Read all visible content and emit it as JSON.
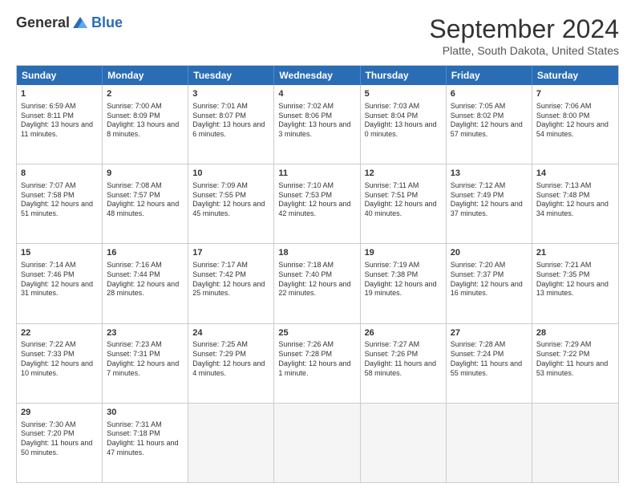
{
  "header": {
    "logo_general": "General",
    "logo_blue": "Blue",
    "title": "September 2024",
    "location": "Platte, South Dakota, United States"
  },
  "days": [
    "Sunday",
    "Monday",
    "Tuesday",
    "Wednesday",
    "Thursday",
    "Friday",
    "Saturday"
  ],
  "rows": [
    [
      {
        "day": "1",
        "sunrise": "Sunrise: 6:59 AM",
        "sunset": "Sunset: 8:11 PM",
        "daylight": "Daylight: 13 hours and 11 minutes."
      },
      {
        "day": "2",
        "sunrise": "Sunrise: 7:00 AM",
        "sunset": "Sunset: 8:09 PM",
        "daylight": "Daylight: 13 hours and 8 minutes."
      },
      {
        "day": "3",
        "sunrise": "Sunrise: 7:01 AM",
        "sunset": "Sunset: 8:07 PM",
        "daylight": "Daylight: 13 hours and 6 minutes."
      },
      {
        "day": "4",
        "sunrise": "Sunrise: 7:02 AM",
        "sunset": "Sunset: 8:06 PM",
        "daylight": "Daylight: 13 hours and 3 minutes."
      },
      {
        "day": "5",
        "sunrise": "Sunrise: 7:03 AM",
        "sunset": "Sunset: 8:04 PM",
        "daylight": "Daylight: 13 hours and 0 minutes."
      },
      {
        "day": "6",
        "sunrise": "Sunrise: 7:05 AM",
        "sunset": "Sunset: 8:02 PM",
        "daylight": "Daylight: 12 hours and 57 minutes."
      },
      {
        "day": "7",
        "sunrise": "Sunrise: 7:06 AM",
        "sunset": "Sunset: 8:00 PM",
        "daylight": "Daylight: 12 hours and 54 minutes."
      }
    ],
    [
      {
        "day": "8",
        "sunrise": "Sunrise: 7:07 AM",
        "sunset": "Sunset: 7:58 PM",
        "daylight": "Daylight: 12 hours and 51 minutes."
      },
      {
        "day": "9",
        "sunrise": "Sunrise: 7:08 AM",
        "sunset": "Sunset: 7:57 PM",
        "daylight": "Daylight: 12 hours and 48 minutes."
      },
      {
        "day": "10",
        "sunrise": "Sunrise: 7:09 AM",
        "sunset": "Sunset: 7:55 PM",
        "daylight": "Daylight: 12 hours and 45 minutes."
      },
      {
        "day": "11",
        "sunrise": "Sunrise: 7:10 AM",
        "sunset": "Sunset: 7:53 PM",
        "daylight": "Daylight: 12 hours and 42 minutes."
      },
      {
        "day": "12",
        "sunrise": "Sunrise: 7:11 AM",
        "sunset": "Sunset: 7:51 PM",
        "daylight": "Daylight: 12 hours and 40 minutes."
      },
      {
        "day": "13",
        "sunrise": "Sunrise: 7:12 AM",
        "sunset": "Sunset: 7:49 PM",
        "daylight": "Daylight: 12 hours and 37 minutes."
      },
      {
        "day": "14",
        "sunrise": "Sunrise: 7:13 AM",
        "sunset": "Sunset: 7:48 PM",
        "daylight": "Daylight: 12 hours and 34 minutes."
      }
    ],
    [
      {
        "day": "15",
        "sunrise": "Sunrise: 7:14 AM",
        "sunset": "Sunset: 7:46 PM",
        "daylight": "Daylight: 12 hours and 31 minutes."
      },
      {
        "day": "16",
        "sunrise": "Sunrise: 7:16 AM",
        "sunset": "Sunset: 7:44 PM",
        "daylight": "Daylight: 12 hours and 28 minutes."
      },
      {
        "day": "17",
        "sunrise": "Sunrise: 7:17 AM",
        "sunset": "Sunset: 7:42 PM",
        "daylight": "Daylight: 12 hours and 25 minutes."
      },
      {
        "day": "18",
        "sunrise": "Sunrise: 7:18 AM",
        "sunset": "Sunset: 7:40 PM",
        "daylight": "Daylight: 12 hours and 22 minutes."
      },
      {
        "day": "19",
        "sunrise": "Sunrise: 7:19 AM",
        "sunset": "Sunset: 7:38 PM",
        "daylight": "Daylight: 12 hours and 19 minutes."
      },
      {
        "day": "20",
        "sunrise": "Sunrise: 7:20 AM",
        "sunset": "Sunset: 7:37 PM",
        "daylight": "Daylight: 12 hours and 16 minutes."
      },
      {
        "day": "21",
        "sunrise": "Sunrise: 7:21 AM",
        "sunset": "Sunset: 7:35 PM",
        "daylight": "Daylight: 12 hours and 13 minutes."
      }
    ],
    [
      {
        "day": "22",
        "sunrise": "Sunrise: 7:22 AM",
        "sunset": "Sunset: 7:33 PM",
        "daylight": "Daylight: 12 hours and 10 minutes."
      },
      {
        "day": "23",
        "sunrise": "Sunrise: 7:23 AM",
        "sunset": "Sunset: 7:31 PM",
        "daylight": "Daylight: 12 hours and 7 minutes."
      },
      {
        "day": "24",
        "sunrise": "Sunrise: 7:25 AM",
        "sunset": "Sunset: 7:29 PM",
        "daylight": "Daylight: 12 hours and 4 minutes."
      },
      {
        "day": "25",
        "sunrise": "Sunrise: 7:26 AM",
        "sunset": "Sunset: 7:28 PM",
        "daylight": "Daylight: 12 hours and 1 minute."
      },
      {
        "day": "26",
        "sunrise": "Sunrise: 7:27 AM",
        "sunset": "Sunset: 7:26 PM",
        "daylight": "Daylight: 11 hours and 58 minutes."
      },
      {
        "day": "27",
        "sunrise": "Sunrise: 7:28 AM",
        "sunset": "Sunset: 7:24 PM",
        "daylight": "Daylight: 11 hours and 55 minutes."
      },
      {
        "day": "28",
        "sunrise": "Sunrise: 7:29 AM",
        "sunset": "Sunset: 7:22 PM",
        "daylight": "Daylight: 11 hours and 53 minutes."
      }
    ],
    [
      {
        "day": "29",
        "sunrise": "Sunrise: 7:30 AM",
        "sunset": "Sunset: 7:20 PM",
        "daylight": "Daylight: 11 hours and 50 minutes."
      },
      {
        "day": "30",
        "sunrise": "Sunrise: 7:31 AM",
        "sunset": "Sunset: 7:18 PM",
        "daylight": "Daylight: 11 hours and 47 minutes."
      },
      null,
      null,
      null,
      null,
      null
    ]
  ]
}
